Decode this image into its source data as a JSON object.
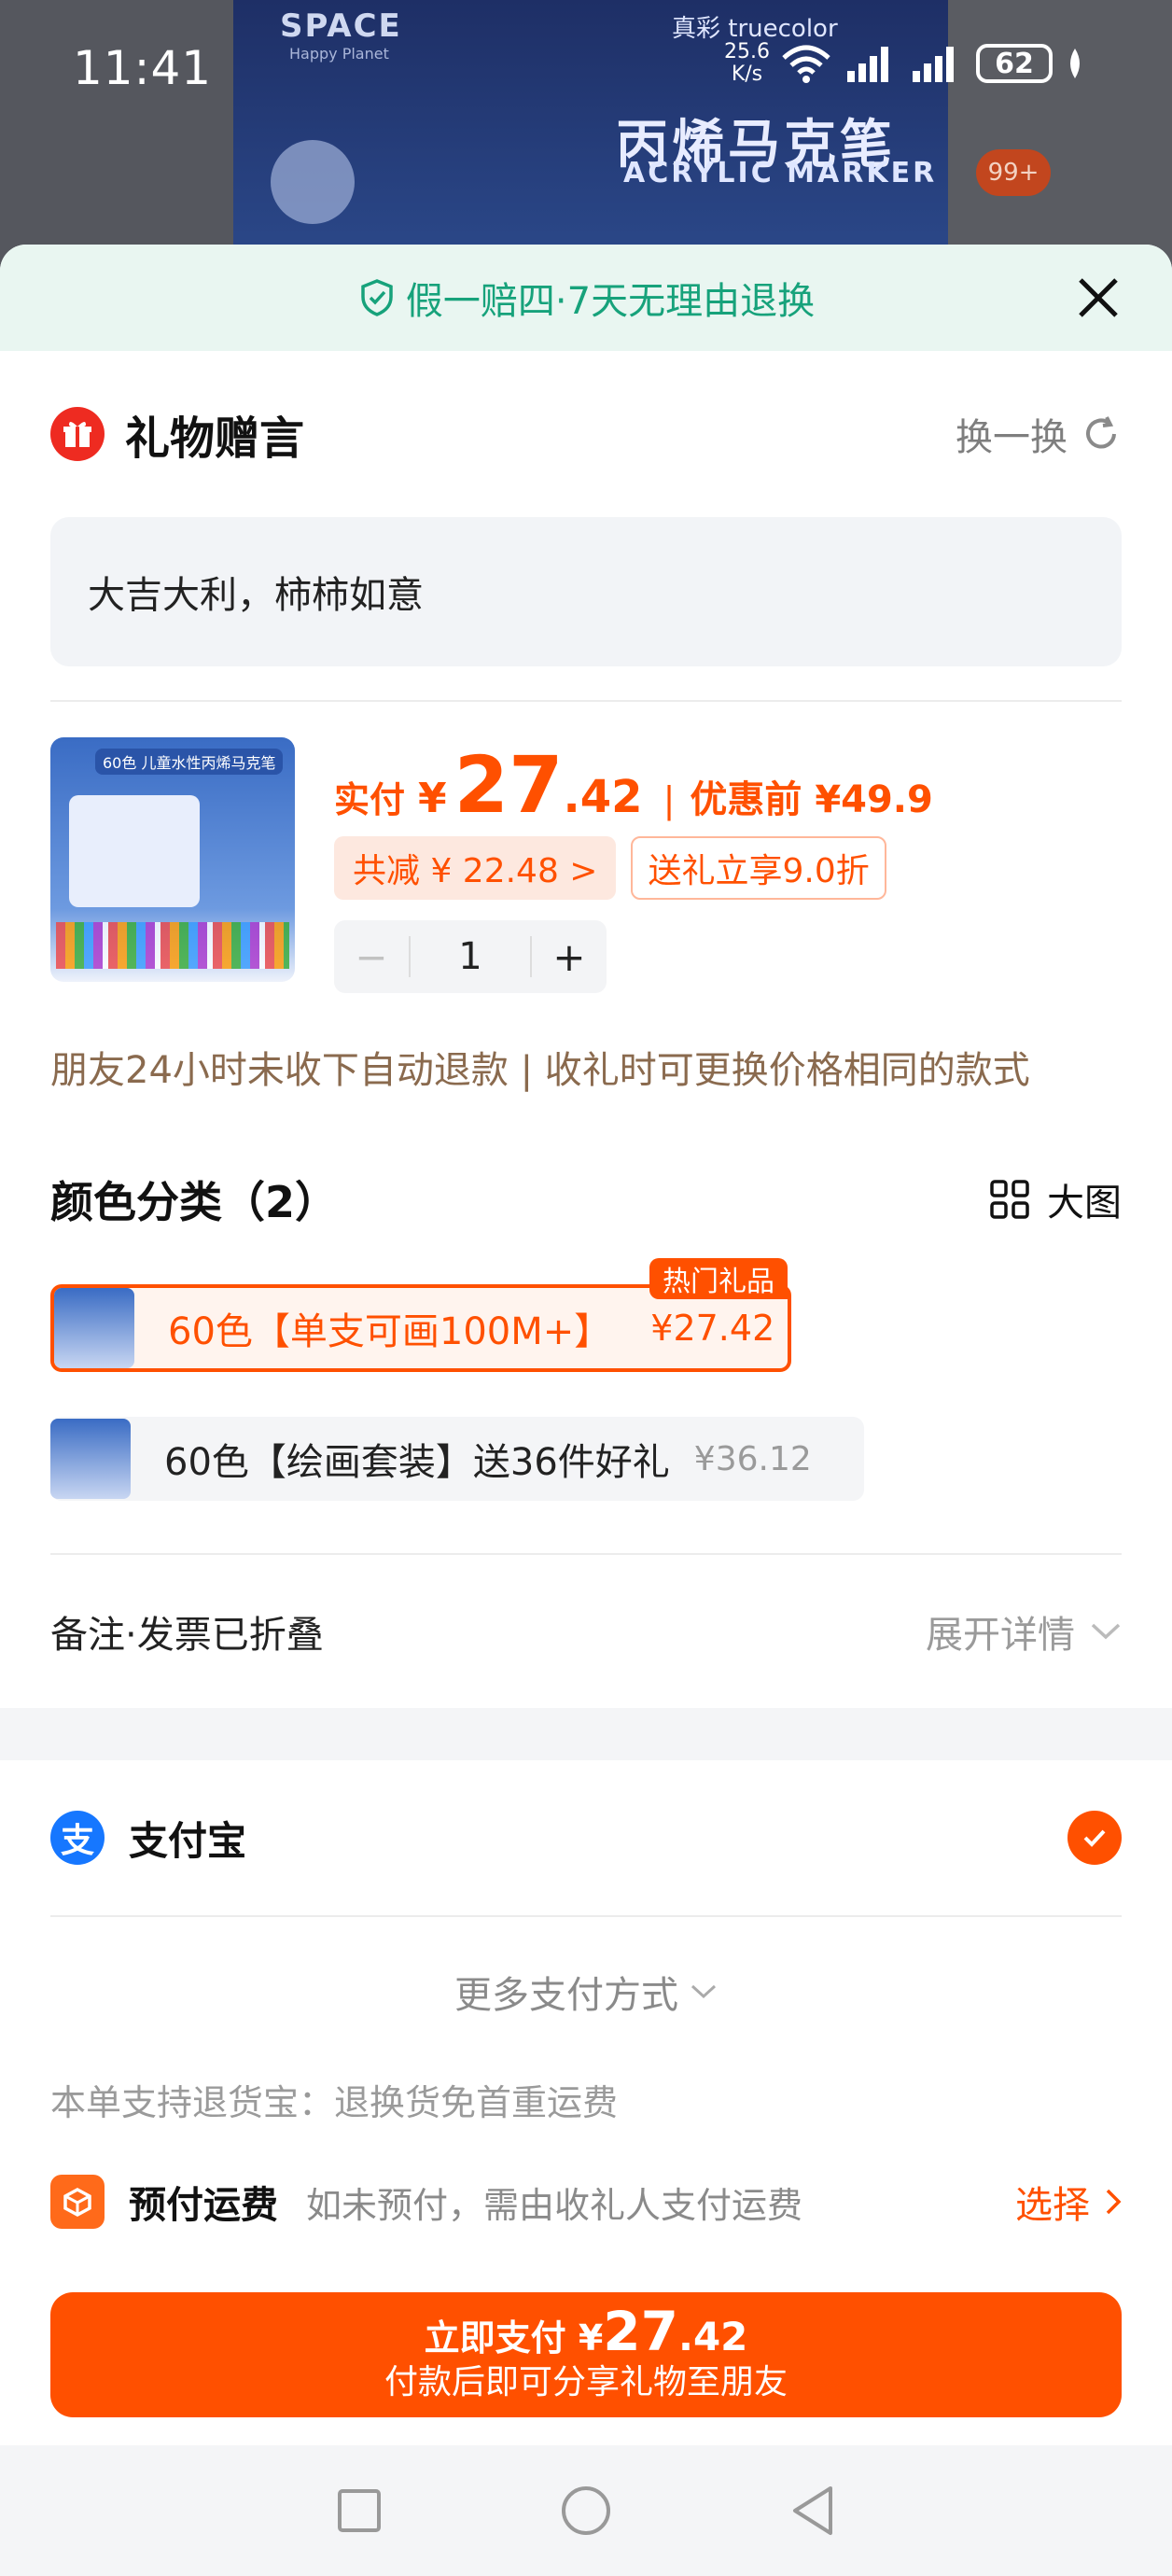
{
  "status_bar": {
    "time": "11:41",
    "net_speed_top": "25.6",
    "net_speed_unit": "K/s",
    "battery": "62"
  },
  "background": {
    "brand": "SPACE",
    "brand_sub": "Happy Planet",
    "brand2": "真彩 truecolor",
    "title_cn": "丙烯马克笔",
    "title_en": "ACRYLIC MARKER",
    "badge": "99+"
  },
  "banner": {
    "text": "假一赔四·7天无理由退换"
  },
  "gift": {
    "title": "礼物赠言",
    "swap": "换一换",
    "message": "大吉大利，柿柿如意"
  },
  "product": {
    "image_label": "60色 儿童水性丙烯马克笔",
    "pay_label": "实付",
    "currency": "¥",
    "price_int": "27",
    "price_dec": ".42",
    "separator": "|",
    "original": "优惠前 ¥49.9",
    "discount_tag": "共减 ¥ 22.48 >",
    "gift_tag": "送礼立享9.0折",
    "qty_minus": "−",
    "quantity": "1",
    "qty_plus": "+"
  },
  "notice": "朋友24小时未收下自动退款 | 收礼时可更换价格相同的款式",
  "colors": {
    "title": "颜色分类（2）",
    "big_view": "大图",
    "options": [
      {
        "name": "60色【单支可画100M+】",
        "price": "¥27.42",
        "hot": "热门礼品"
      },
      {
        "name": "60色【绘画套装】送36件好礼",
        "price": "¥36.12"
      }
    ]
  },
  "remark": {
    "label": "备注·发票已折叠",
    "expand": "展开详情"
  },
  "payment": {
    "method": "支付宝",
    "ali_glyph": "支",
    "more": "更多支付方式",
    "refund_note": "本单支持退货宝：退换货免首重运费",
    "ship_title": "预付运费",
    "ship_desc": "如未预付，需由收礼人支付运费",
    "ship_action": "选择"
  },
  "pay_button": {
    "label": "立即支付",
    "currency": "¥",
    "int": "27",
    "dec": ".42",
    "sub": "付款后即可分享礼物至朋友"
  },
  "colors_palette": {
    "accent": "#ff5000",
    "green": "#17a27b",
    "alipay": "#1677ff"
  }
}
